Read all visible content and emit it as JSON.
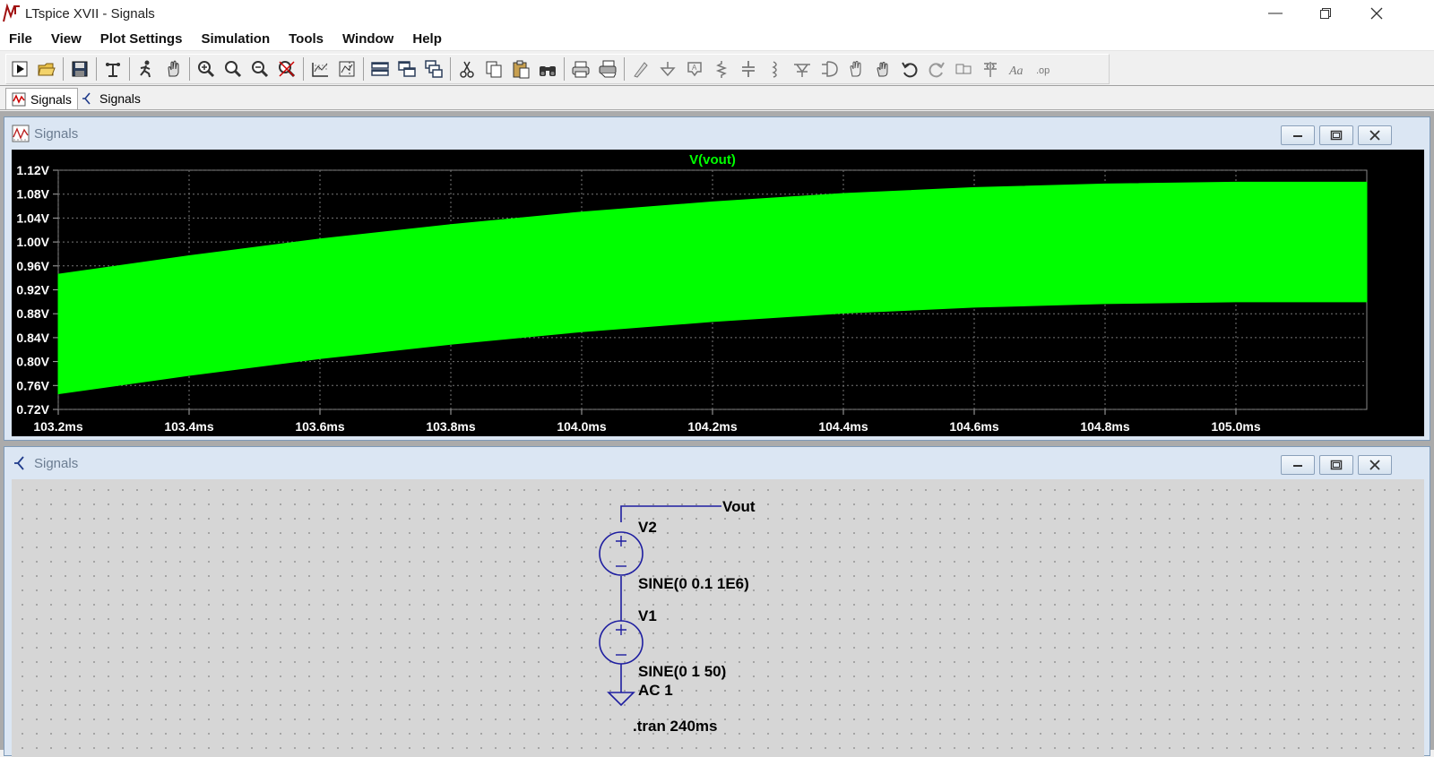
{
  "window": {
    "title": "LTspice XVII - Signals",
    "controls": [
      "minimize-icon",
      "restore-icon",
      "close-icon"
    ]
  },
  "menu": [
    "File",
    "View",
    "Plot Settings",
    "Simulation",
    "Tools",
    "Window",
    "Help"
  ],
  "toolbar": {
    "icons": [
      "run-icon",
      "open-icon",
      "sep",
      "save-icon",
      "sep",
      "control-panel-icon",
      "sep",
      "run-sim-icon",
      "halt-icon",
      "sep",
      "zoom-area-icon",
      "zoom-in-icon",
      "zoom-out-icon",
      "zoom-cancel-icon",
      "sep",
      "autorange-icon",
      "manual-limits-icon",
      "sep",
      "tile-horizontal-icon",
      "tile-vertical-icon",
      "cascade-icon",
      "sep",
      "cut-icon",
      "copy-icon",
      "paste-icon",
      "find-icon",
      "sep",
      "print-icon",
      "print-setup-icon",
      "sep",
      "wire-icon",
      "ground-icon",
      "label-net-icon",
      "resistor-icon",
      "capacitor-icon",
      "inductor-icon",
      "diode-icon",
      "component-icon",
      "move-icon",
      "drag-icon",
      "undo-icon",
      "redo-icon",
      "rotate-icon",
      "mirror-icon",
      "text-icon",
      "spice-directive-icon"
    ]
  },
  "tabs": [
    {
      "label": "Signals",
      "kind": "waveform",
      "active": true
    },
    {
      "label": "Signals",
      "kind": "schematic",
      "active": false
    }
  ],
  "plot_window": {
    "title": "Signals",
    "trace_label": "V(vout)",
    "trace_color": "#00ff00"
  },
  "chart_data": {
    "type": "area",
    "title": "V(vout)",
    "x_unit": "ms",
    "xlim": [
      103.2,
      105.2
    ],
    "ylim": [
      0.72,
      1.12
    ],
    "x_ticks": [
      "103.2ms",
      "103.4ms",
      "103.6ms",
      "103.8ms",
      "104.0ms",
      "104.2ms",
      "104.4ms",
      "104.6ms",
      "104.8ms",
      "105.0ms"
    ],
    "y_ticks": [
      "1.12V",
      "1.08V",
      "1.04V",
      "1.00V",
      "0.96V",
      "0.92V",
      "0.88V",
      "0.84V",
      "0.80V",
      "0.76V",
      "0.72V"
    ],
    "grid": true,
    "series": [
      {
        "name": "V(vout)",
        "color": "#00ff00",
        "x": [
          103.2,
          103.4,
          103.6,
          103.8,
          104.0,
          104.2,
          104.4,
          104.6,
          104.8,
          105.0,
          105.2
        ],
        "upper": [
          0.946,
          0.977,
          1.005,
          1.029,
          1.05,
          1.067,
          1.081,
          1.091,
          1.097,
          1.1,
          1.1
        ],
        "lower": [
          0.746,
          0.777,
          0.805,
          0.829,
          0.85,
          0.867,
          0.881,
          0.891,
          0.897,
          0.9,
          0.9
        ]
      }
    ]
  },
  "schematic_window": {
    "title": "Signals",
    "net_label": "Vout",
    "v2_name": "V2",
    "v2_value": "SINE(0 0.1 1E6)",
    "v1_name": "V1",
    "v1_value": "SINE(0 1 50)",
    "v1_ac": "AC 1",
    "directive": ".tran 240ms",
    "wire_color": "#1e1ea0",
    "source_color": "#1e1ea0"
  }
}
